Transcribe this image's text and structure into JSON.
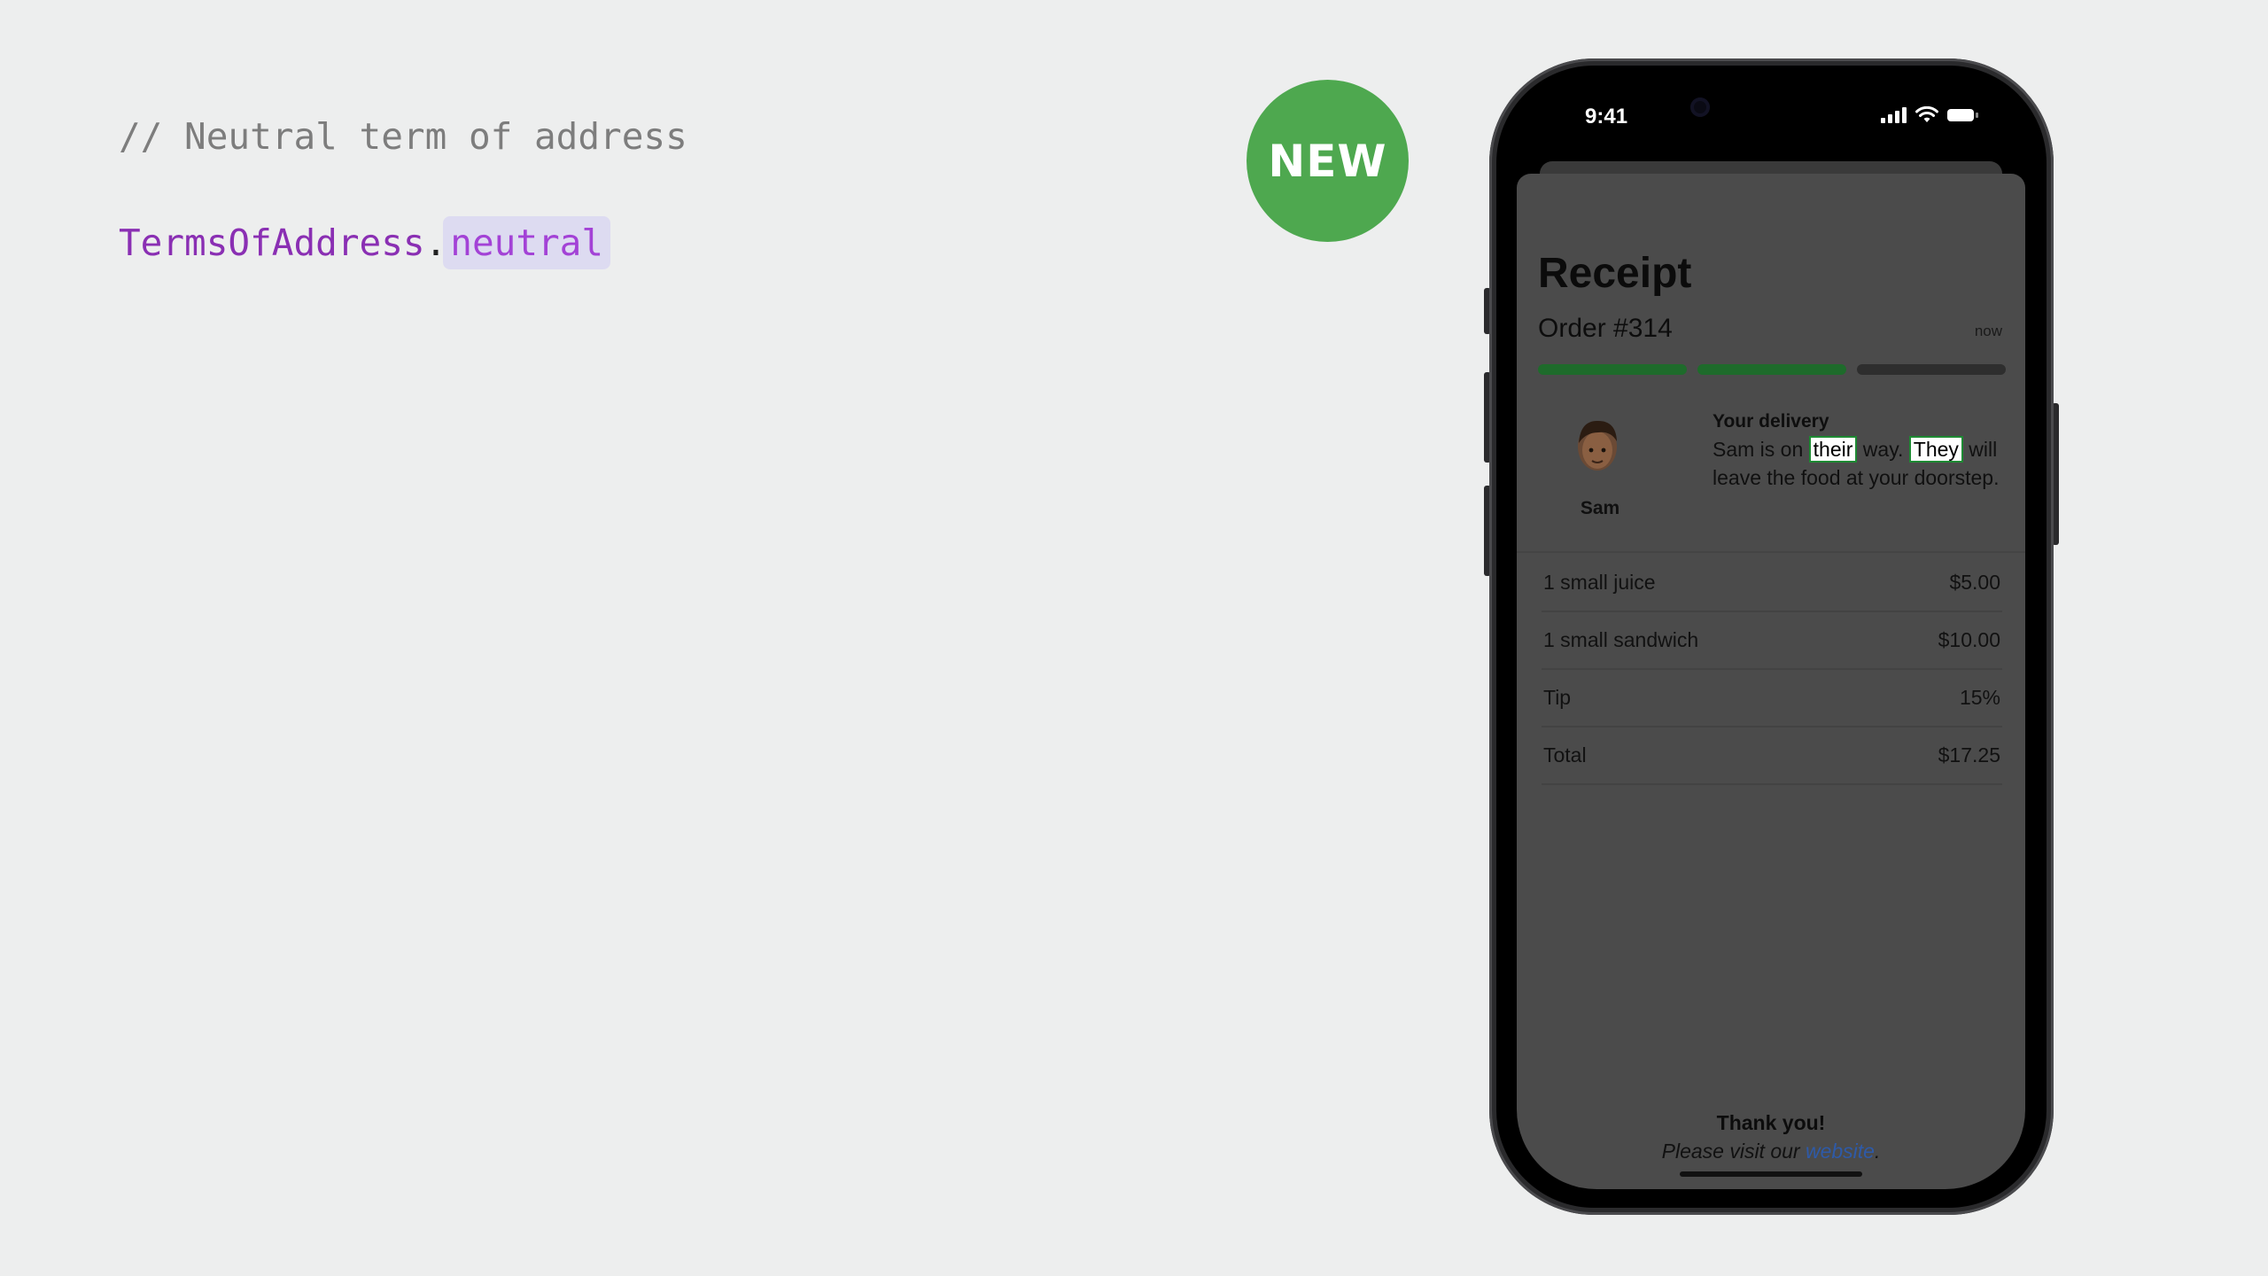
{
  "slide": {
    "comment": "// Neutral term of address",
    "code_type": "TermsOfAddress",
    "code_dot": ".",
    "code_member": "neutral",
    "badge": "NEW"
  },
  "status_bar": {
    "time": "9:41"
  },
  "receipt": {
    "title": "Receipt",
    "order": "Order #314",
    "time": "now",
    "progress_steps_total": 3,
    "progress_steps_complete": 2,
    "courier_name": "Sam",
    "delivery_heading": "Your delivery",
    "delivery_text_1": "Sam is on ",
    "delivery_pronoun_1": "their",
    "delivery_text_2": " way. ",
    "delivery_pronoun_2": "They",
    "delivery_text_3": " will leave the food at your doorstep.",
    "items": [
      {
        "label": "1 small juice",
        "value": "$5.00"
      },
      {
        "label": "1 small sandwich",
        "value": "$10.00"
      },
      {
        "label": "Tip",
        "value": "15%"
      },
      {
        "label": "Total",
        "value": "$17.25"
      }
    ],
    "thanks": "Thank you!",
    "visit_prefix": "Please visit our ",
    "visit_link": "website",
    "visit_suffix": "."
  },
  "colors": {
    "badge": "#4ea84f",
    "progress_done": "#1e6b2b",
    "highlight_border": "#1e8a33",
    "link": "#2e5aa8"
  }
}
